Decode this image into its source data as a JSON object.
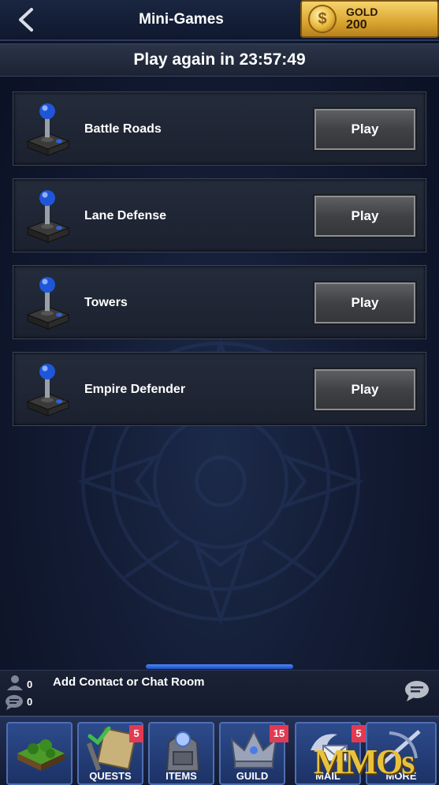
{
  "header": {
    "title": "Mini-Games",
    "gold": {
      "label": "GOLD",
      "value": "200"
    }
  },
  "timer": {
    "text": "Play again in 23:57:49"
  },
  "games": [
    {
      "name": "Battle Roads",
      "button": "Play"
    },
    {
      "name": "Lane Defense",
      "button": "Play"
    },
    {
      "name": "Towers",
      "button": "Play"
    },
    {
      "name": "Empire Defender",
      "button": "Play"
    }
  ],
  "chat": {
    "contacts_count": "0",
    "messages_count": "0",
    "add_label": "Add Contact or Chat Room"
  },
  "nav": {
    "items": [
      {
        "label": "",
        "icon": "island-icon"
      },
      {
        "label": "QUESTS",
        "icon": "scroll-icon",
        "badge": "5"
      },
      {
        "label": "ITEMS",
        "icon": "backpack-icon"
      },
      {
        "label": "GUILD",
        "icon": "crown-icon",
        "badge": "15"
      },
      {
        "label": "MAIL",
        "icon": "winged-mail-icon",
        "badge": "5"
      },
      {
        "label": "MORE",
        "icon": "more-icon"
      }
    ]
  },
  "watermark": "MMOs",
  "colors": {
    "gold": "#e7b73b",
    "badge": "#e23a52",
    "nav_blue": "#2d4b8c"
  }
}
